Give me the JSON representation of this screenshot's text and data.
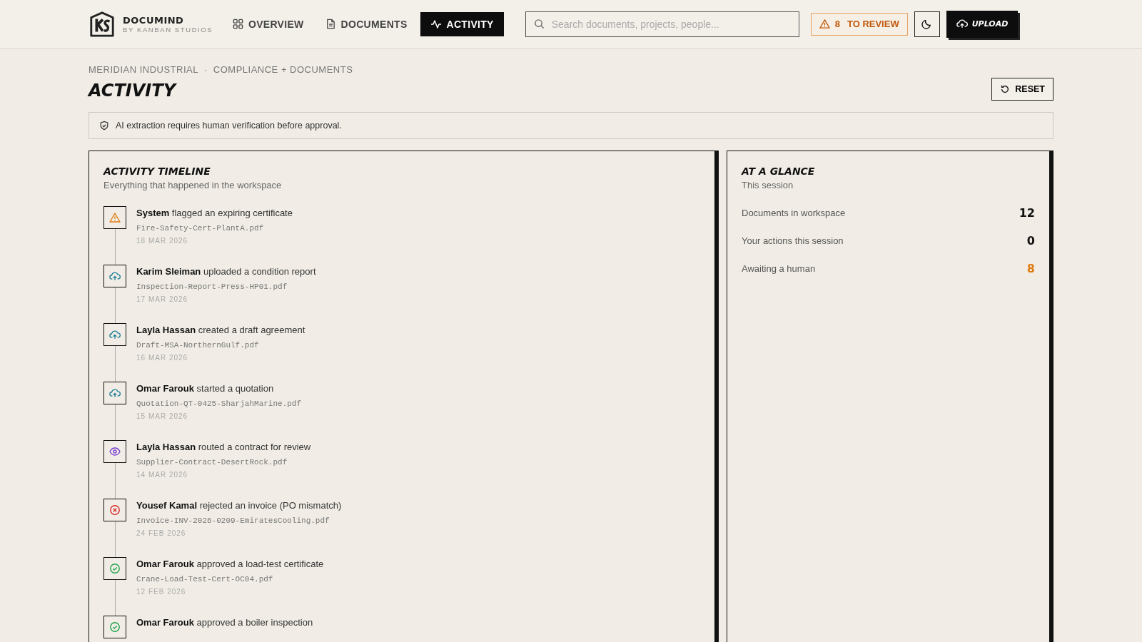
{
  "brand": {
    "name": "DOCUMIND",
    "tagline": "BY KANBAN STUDIOS"
  },
  "nav": [
    {
      "label": "OVERVIEW",
      "kind": "grid",
      "selected": false
    },
    {
      "label": "DOCUMENTS",
      "kind": "file",
      "selected": false
    },
    {
      "label": "ACTIVITY",
      "kind": "pulse",
      "selected": true
    }
  ],
  "search": {
    "placeholder": "Search documents, projects, people..."
  },
  "review_button": {
    "count": "8",
    "label": "TO REVIEW"
  },
  "upload_button": "UPLOAD",
  "breadcrumb": [
    "MERIDIAN INDUSTRIAL",
    "·",
    "COMPLIANCE + DOCUMENTS"
  ],
  "page_title": "ACTIVITY",
  "reset_button": "RESET",
  "notice": "AI extraction requires human verification before approval.",
  "timeline": {
    "title": "ACTIVITY TIMELINE",
    "subtitle": "Everything that happened in the workspace",
    "events": [
      {
        "kind": "warning",
        "actor": "System",
        "action": "flagged an expiring certificate",
        "file": "Fire-Safety-Cert-PlantA.pdf",
        "date": "18 MAR 2026"
      },
      {
        "kind": "upload",
        "actor": "Karim Sleiman",
        "action": "uploaded a condition report",
        "file": "Inspection-Report-Press-HP01.pdf",
        "date": "17 MAR 2026"
      },
      {
        "kind": "upload",
        "actor": "Layla Hassan",
        "action": "created a draft agreement",
        "file": "Draft-MSA-NorthernGulf.pdf",
        "date": "16 MAR 2026"
      },
      {
        "kind": "upload",
        "actor": "Omar Farouk",
        "action": "started a quotation",
        "file": "Quotation-QT-0425-SharjahMarine.pdf",
        "date": "15 MAR 2026"
      },
      {
        "kind": "review",
        "actor": "Layla Hassan",
        "action": "routed a contract for review",
        "file": "Supplier-Contract-DesertRock.pdf",
        "date": "14 MAR 2026"
      },
      {
        "kind": "reject",
        "actor": "Yousef Kamal",
        "action": "rejected an invoice (PO mismatch)",
        "file": "Invoice-INV-2026-0209-EmiratesCooling.pdf",
        "date": "24 FEB 2026"
      },
      {
        "kind": "approve",
        "actor": "Omar Farouk",
        "action": "approved a load-test certificate",
        "file": "Crane-Load-Test-Cert-OC04.pdf",
        "date": "12 FEB 2026"
      },
      {
        "kind": "approve",
        "actor": "Omar Farouk",
        "action": "approved a boiler inspection"
      }
    ]
  },
  "glance": {
    "title": "AT A GLANCE",
    "subtitle": "This session",
    "stats": [
      {
        "label": "Documents in workspace",
        "value": "12",
        "color": "#111111"
      },
      {
        "label": "Your actions this session",
        "value": "0",
        "color": "#111111"
      },
      {
        "label": "Awaiting a human",
        "value": "8",
        "color": "#e07b12"
      }
    ]
  }
}
